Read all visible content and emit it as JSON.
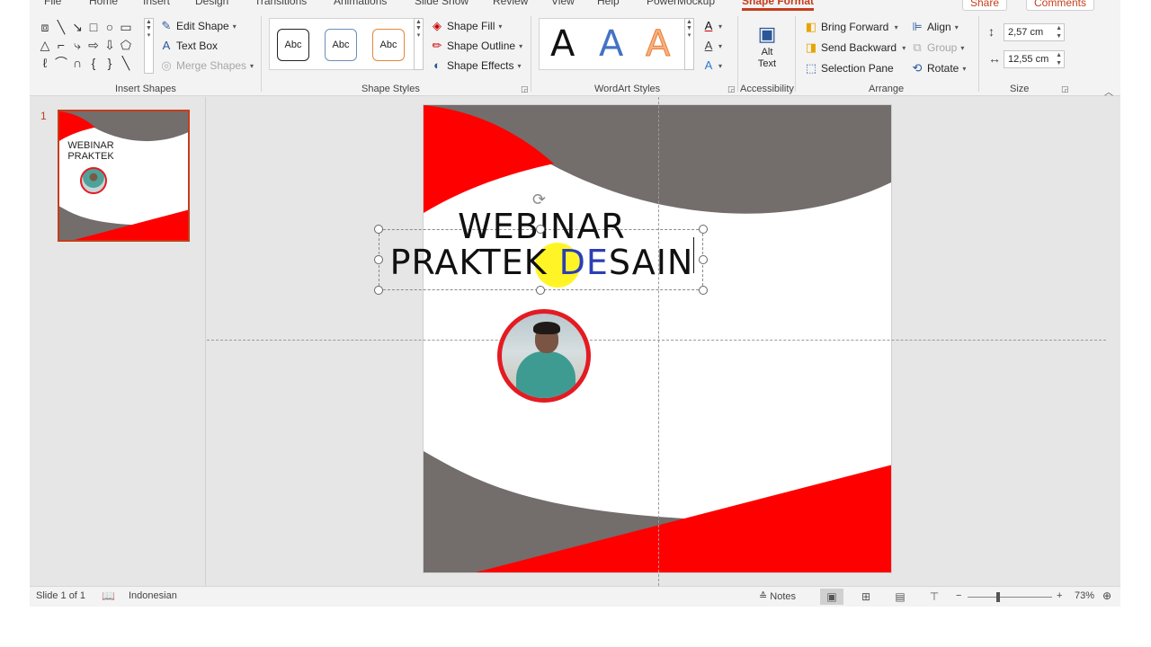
{
  "tabs": [
    "File",
    "Home",
    "Insert",
    "Design",
    "Transitions",
    "Animations",
    "Slide Show",
    "Review",
    "View",
    "Help",
    "PowerMockup",
    "Shape Format"
  ],
  "active_tab": "Shape Format",
  "top_buttons": {
    "share": "Share",
    "comments": "Comments"
  },
  "ribbon": {
    "insert_shapes": {
      "label": "Insert Shapes",
      "edit_shape": "Edit Shape",
      "text_box": "Text Box",
      "merge_shapes": "Merge Shapes"
    },
    "shape_styles": {
      "label": "Shape Styles",
      "presets": [
        "Abc",
        "Abc",
        "Abc"
      ],
      "shape_fill": "Shape Fill",
      "shape_outline": "Shape Outline",
      "shape_effects": "Shape Effects"
    },
    "wordart_styles": {
      "label": "WordArt Styles",
      "presets": [
        "A",
        "A",
        "A"
      ]
    },
    "accessibility": {
      "label": "Accessibility",
      "alt_text_line1": "Alt",
      "alt_text_line2": "Text"
    },
    "arrange": {
      "label": "Arrange",
      "bring_forward": "Bring Forward",
      "send_backward": "Send Backward",
      "selection_pane": "Selection Pane",
      "align": "Align",
      "group": "Group",
      "rotate": "Rotate"
    },
    "size": {
      "label": "Size",
      "height": "2,57 cm",
      "width": "12,55 cm"
    }
  },
  "thumbnail": {
    "number": "1",
    "title_line1": "WEBINAR",
    "title_line2": "PRAKTEK"
  },
  "slide": {
    "title_line1": "WEBINAR",
    "title_line2_a": "PRAKTEK ",
    "title_line2_b": "DE",
    "title_line2_c": "SAIN"
  },
  "status": {
    "slide_count": "Slide 1 of 1",
    "language": "Indonesian",
    "notes": "Notes",
    "zoom_minus": "−",
    "zoom_plus": "+",
    "zoom": "73%"
  },
  "colors": {
    "accent": "#c43e1c",
    "slide_red": "#ff0000",
    "slide_gray": "#736d6c"
  },
  "icons": [
    "edit-shape-icon",
    "text-box-icon",
    "merge-shapes-icon",
    "shape-fill-icon",
    "shape-outline-icon",
    "shape-effects-icon",
    "alt-text-icon",
    "bring-forward-icon",
    "send-backward-icon",
    "selection-pane-icon",
    "align-icon",
    "group-icon",
    "rotate-icon",
    "height-icon",
    "width-icon",
    "notes-icon",
    "spellcheck-icon"
  ]
}
